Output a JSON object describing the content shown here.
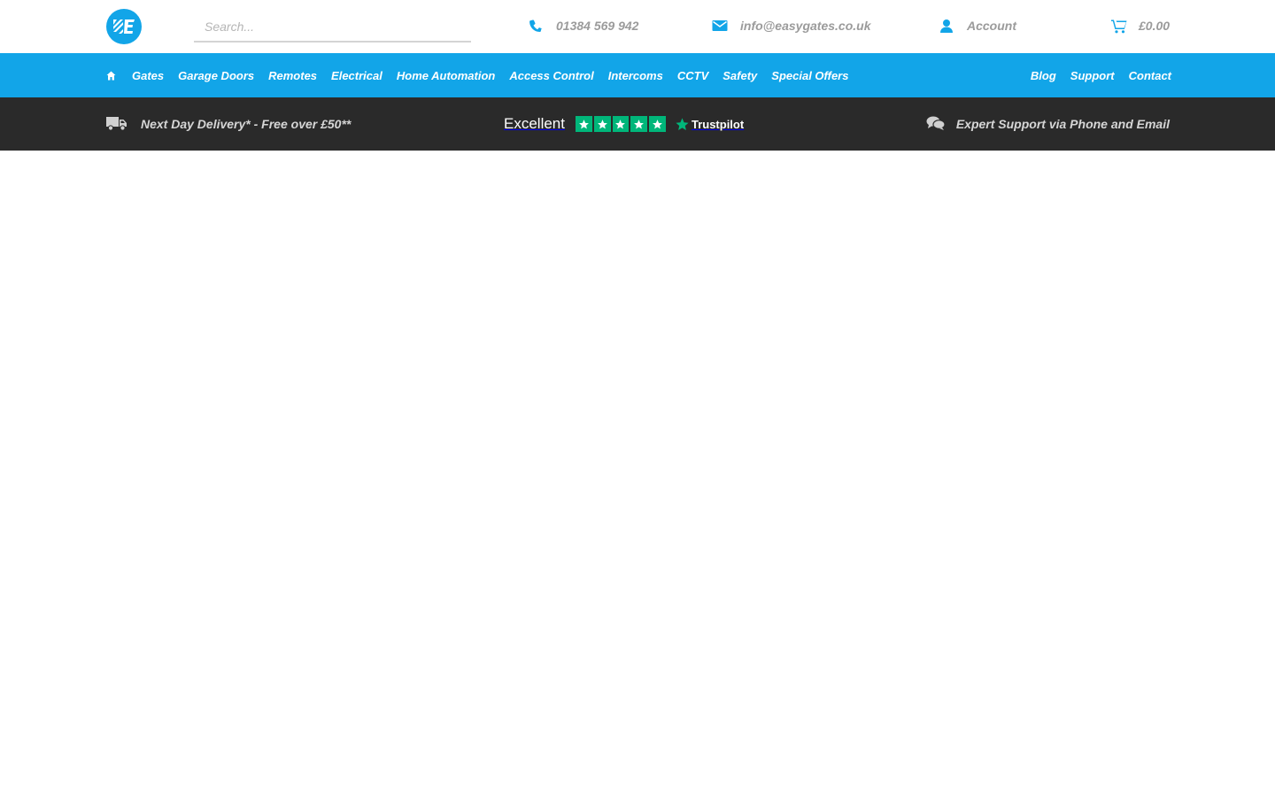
{
  "header": {
    "logo_alt": "E",
    "search": {
      "placeholder": "Search...",
      "value": ""
    },
    "phone": "01384 569 942",
    "email": "info@easygates.co.uk",
    "account": "Account",
    "cart_total": "£0.00"
  },
  "nav": {
    "left_items": [
      {
        "label": "Gates"
      },
      {
        "label": "Garage Doors"
      },
      {
        "label": "Remotes"
      },
      {
        "label": "Electrical"
      },
      {
        "label": "Home Automation"
      },
      {
        "label": "Access Control"
      },
      {
        "label": "Intercoms"
      },
      {
        "label": "CCTV"
      },
      {
        "label": "Safety"
      },
      {
        "label": "Special Offers"
      }
    ],
    "right_items": [
      {
        "label": "Blog"
      },
      {
        "label": "Support"
      },
      {
        "label": "Contact"
      }
    ]
  },
  "infobar": {
    "delivery": "Next Day Delivery* - Free over £50**",
    "trustpilot_rating": "Excellent",
    "trustpilot_stars": 5,
    "trustpilot_brand": "Trustpilot",
    "support": "Expert Support via Phone and Email"
  },
  "colors": {
    "brand_blue": "#12a5e8",
    "infobar_bg": "#2a2a2a",
    "trustpilot_green": "#00b67a",
    "link_grey": "#9b9b9b"
  },
  "icons": [
    "logo-icon",
    "phone-icon",
    "envelope-icon",
    "user-icon",
    "cart-icon",
    "home-icon",
    "truck-icon",
    "chat-icon",
    "star-icon"
  ]
}
